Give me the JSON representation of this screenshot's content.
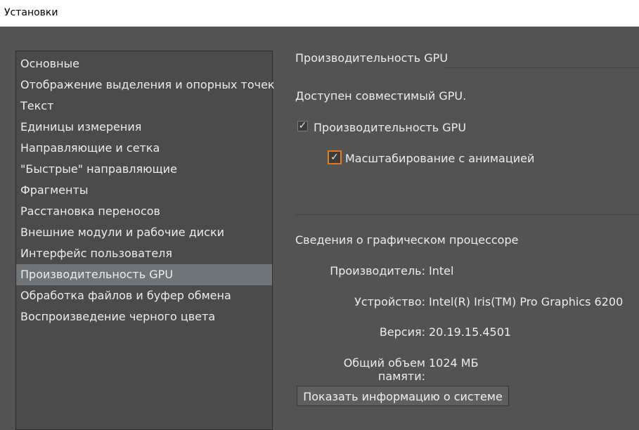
{
  "window": {
    "title": "Установки"
  },
  "sidebar": {
    "items": [
      {
        "label": "Основные"
      },
      {
        "label": "Отображение выделения и опорных точек"
      },
      {
        "label": "Текст"
      },
      {
        "label": "Единицы измерения"
      },
      {
        "label": "Направляющие и сетка"
      },
      {
        "label": "\"Быстрые\" направляющие"
      },
      {
        "label": "Фрагменты"
      },
      {
        "label": "Расстановка переносов"
      },
      {
        "label": "Внешние модули и рабочие диски"
      },
      {
        "label": "Интерфейс пользователя"
      },
      {
        "label": "Производительность GPU"
      },
      {
        "label": "Обработка файлов и буфер обмена"
      },
      {
        "label": "Воспроизведение черного цвета"
      }
    ],
    "selected": "Производительность GPU"
  },
  "main": {
    "section_title": "Производительность GPU",
    "compatible_text": "Доступен совместимый GPU.",
    "gpu_checkbox": {
      "label": "Производительность GPU",
      "checked": true,
      "mark": "✓"
    },
    "animated_zoom_checkbox": {
      "label": "Масштабирование с анимацией",
      "checked": true,
      "mark": "✓"
    },
    "gpu_info": {
      "heading": "Сведения о графическом процессоре",
      "vendor_label": "Производитель:",
      "vendor_value": "Intel",
      "device_label": "Устройство:",
      "device_value": "Intel(R) Iris(TM) Pro Graphics 6200",
      "version_label": "Версия:",
      "version_value": "20.19.15.4501",
      "memory_label": "Общий объем памяти:",
      "memory_value": "1024 МБ"
    },
    "system_info_button": "Показать информацию о системе"
  },
  "colors": {
    "background": "#535353",
    "list_background": "#4b4b4b",
    "selection": "#6e7478",
    "focus_accent": "#e07a1c",
    "text": "#ececec"
  }
}
